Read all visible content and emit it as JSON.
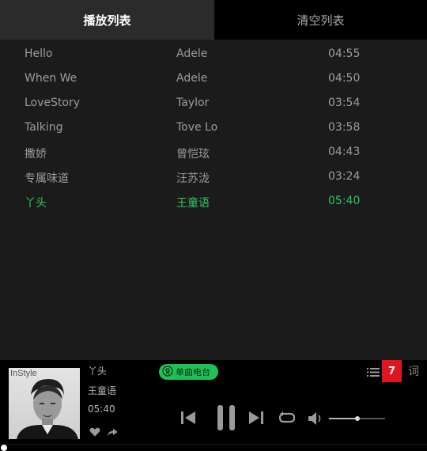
{
  "tabs": [
    {
      "label": "播放列表",
      "active": true
    },
    {
      "label": "清空列表",
      "active": false
    }
  ],
  "playlist": [
    {
      "title": "Hello",
      "artist": "Adele",
      "duration": "04:55"
    },
    {
      "title": "When We",
      "artist": "Adele",
      "duration": "04:50"
    },
    {
      "title": "LoveStory",
      "artist": "Taylor",
      "duration": "03:54"
    },
    {
      "title": "Talking",
      "artist": "Tove Lo",
      "duration": "03:58"
    },
    {
      "title": "撒娇",
      "artist": "曾恺玹",
      "duration": "04:43"
    },
    {
      "title": "专属味道",
      "artist": "汪苏泷",
      "duration": "03:24"
    },
    {
      "title": "丫头",
      "artist": "王童语",
      "duration": "05:40",
      "playing": true
    }
  ],
  "now_playing": {
    "title": "丫头",
    "artist": "王童语",
    "time": "05:40",
    "cover_text": "InStyle",
    "radio_label": "单曲电台",
    "playlist_count": "7",
    "lyrics_label": "词",
    "volume_fraction": 0.5,
    "progress_fraction": 0.0
  },
  "colors": {
    "accent_green": "#2fc45a",
    "badge_red": "#e0161e",
    "background": "#1b1b1b",
    "player_bar": "#000000"
  },
  "icons": {
    "like": "heart-icon",
    "share": "share-icon",
    "radio": "radio-icon",
    "list": "list-icon",
    "prev": "skip-previous-icon",
    "pause": "pause-icon",
    "next": "skip-next-icon",
    "loop": "loop-icon",
    "volume": "volume-icon"
  }
}
